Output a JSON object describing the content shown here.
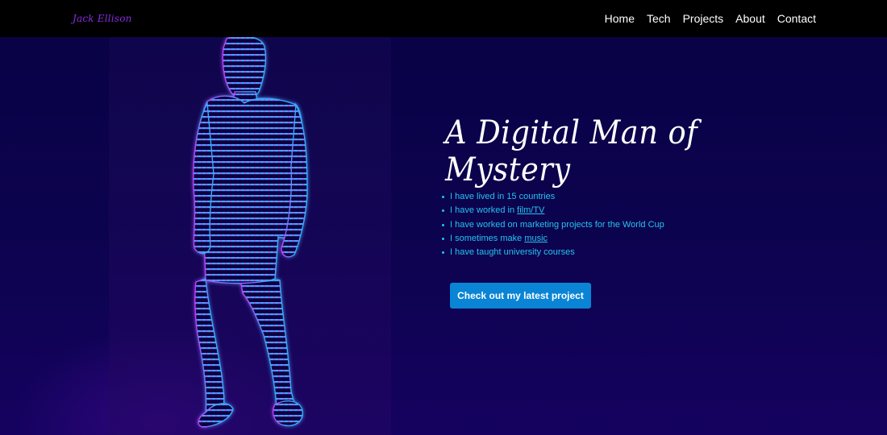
{
  "navbar": {
    "logo_text": "Jack Ellison",
    "links": [
      "Home",
      "Tech",
      "Projects",
      "About",
      "Contact"
    ]
  },
  "hero": {
    "title": "A Digital Man of Mystery",
    "facts": [
      {
        "prefix": "I have lived in 15 countries",
        "link": "",
        "suffix": ""
      },
      {
        "prefix": "I have worked in ",
        "link": "film/TV",
        "suffix": ""
      },
      {
        "prefix": "I have worked on marketing projects for the World Cup",
        "link": "",
        "suffix": ""
      },
      {
        "prefix": "I sometimes make ",
        "link": "music",
        "suffix": ""
      },
      {
        "prefix": "I have taught university courses",
        "link": "",
        "suffix": ""
      }
    ],
    "cta_label": "Check out my latest project"
  },
  "colors": {
    "background": "#0b0340",
    "navbar": "#000000",
    "logo": "#8a2be2",
    "fact_text": "#23c4f0",
    "cta": "#0a84d4",
    "figure_blue": "#3aa8ff",
    "figure_magenta": "#c23bff"
  }
}
